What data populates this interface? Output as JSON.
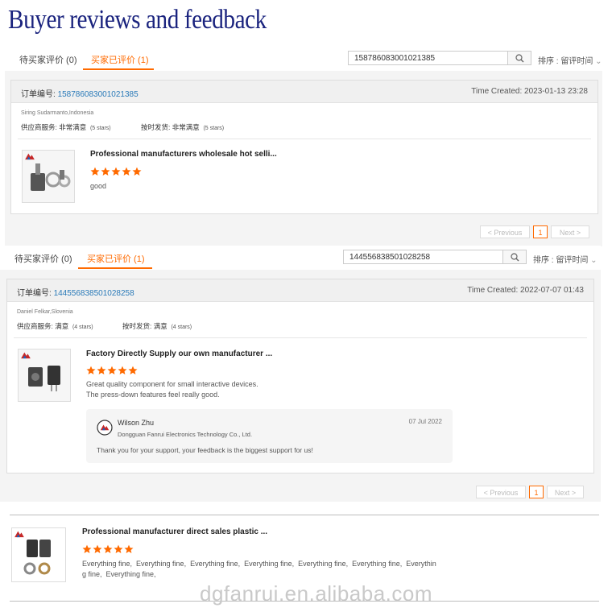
{
  "page_title": "Buyer reviews and feedback",
  "brand_color": "#ff6a00",
  "section1": {
    "tab_pending": "待买家评价 (0)",
    "tab_done": "买家已评价 (1)",
    "search_value": "158786083001021385",
    "sort_label": "排序 : 留评时间",
    "order_label": "订单编号:",
    "order_number": "158786083001021385",
    "time_created": "Time Created: 2023-01-13 23:28",
    "buyer": "Siring Sudarmanto,Indonesia",
    "supplier_service": "供应商服务: 非常满意",
    "supplier_stars": "(5 stars)",
    "ontime_delivery": "按时发货: 非常满意",
    "ontime_stars": "(5 stars)",
    "product_title": "Professional manufacturers wholesale hot selli...",
    "stars": 5,
    "review": "good",
    "pager_prev": "< Previous",
    "pager_page": "1",
    "pager_next": "Next >"
  },
  "section2": {
    "tab_pending": "待买家评价 (0)",
    "tab_done": "买家已评价 (1)",
    "search_value": "144556838501028258",
    "sort_label": "排序 : 留评时间",
    "order_label": "订单编号:",
    "order_number": "144556838501028258",
    "time_created": "Time Created: 2022-07-07 01:43",
    "buyer": "Daniel Felkar,Slovenia",
    "supplier_service": "供应商服务: 满意",
    "supplier_stars": "(4 stars)",
    "ontime_delivery": "按时发货: 满意",
    "ontime_stars": "(4 stars)",
    "product_title": "Factory Directly Supply our own manufacturer ...",
    "stars": 5,
    "review_line1": "Great quality component for small interactive devices.",
    "review_line2": "The press-down features feel really good.",
    "reply_name": "Wilson Zhu",
    "reply_company": "Dongguan Fanrui Electronics Technology Co., Ltd.",
    "reply_date": "07 Jul 2022",
    "reply_text": "Thank you for your support, your feedback is the biggest support for us!",
    "pager_prev": "< Previous",
    "pager_page": "1",
    "pager_next": "Next >"
  },
  "section3": {
    "product_title": "Professional manufacturer direct sales plastic ...",
    "stars": 5,
    "review_line1": "Everything fine,  Everything fine,  Everything fine,  Everything fine,  Everything fine,  Everything fine,  Everythin",
    "review_line2": "g fine,  Everything fine,"
  },
  "watermark": "dgfanrui.en.alibaba.com"
}
